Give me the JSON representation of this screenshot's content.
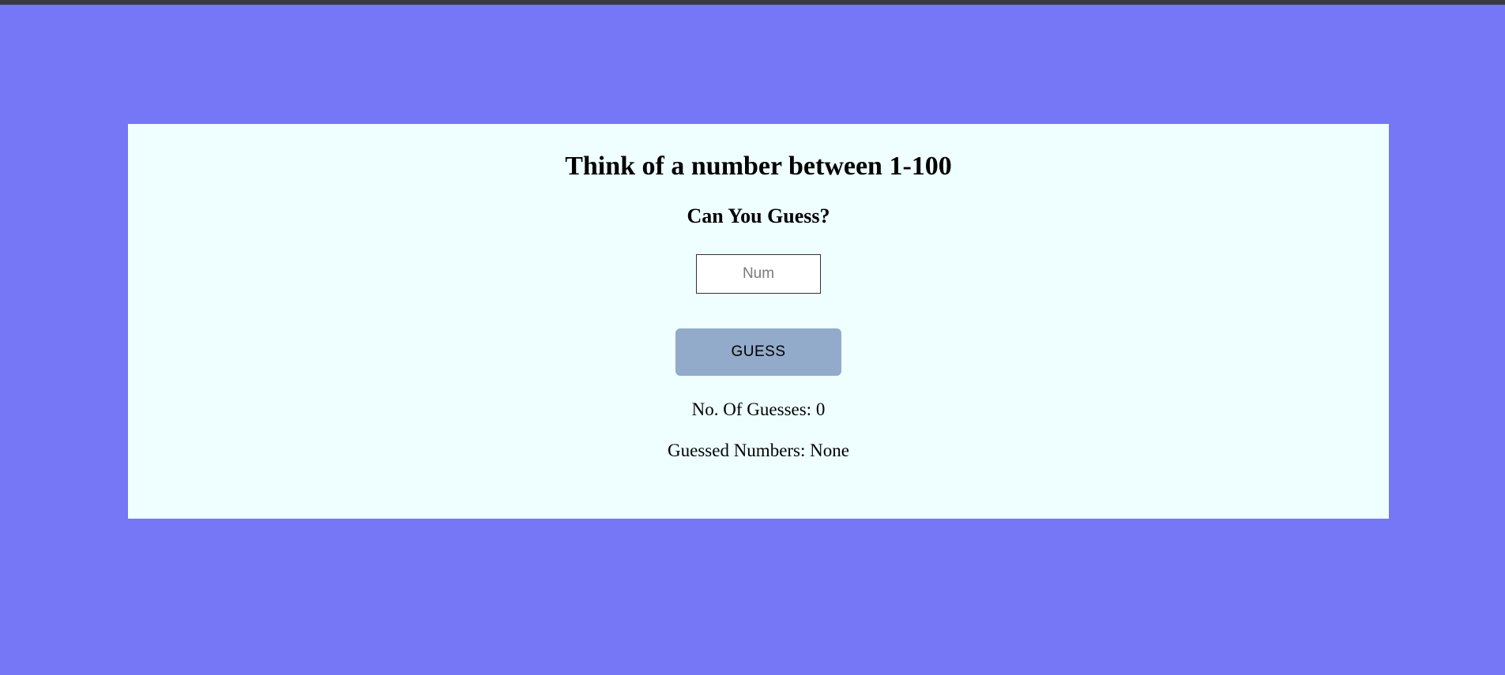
{
  "game": {
    "title": "Think of a number between 1-100",
    "subtitle": "Can You Guess?",
    "input_placeholder": "Num",
    "input_value": "",
    "button_label": "GUESS",
    "guess_count_label": "No. Of Guesses: ",
    "guess_count": "0",
    "guessed_numbers_label": "Guessed Numbers: ",
    "guessed_numbers": "None"
  },
  "colors": {
    "page_background": "#7577f6",
    "card_background": "#efffff",
    "button_background": "#93abca"
  }
}
